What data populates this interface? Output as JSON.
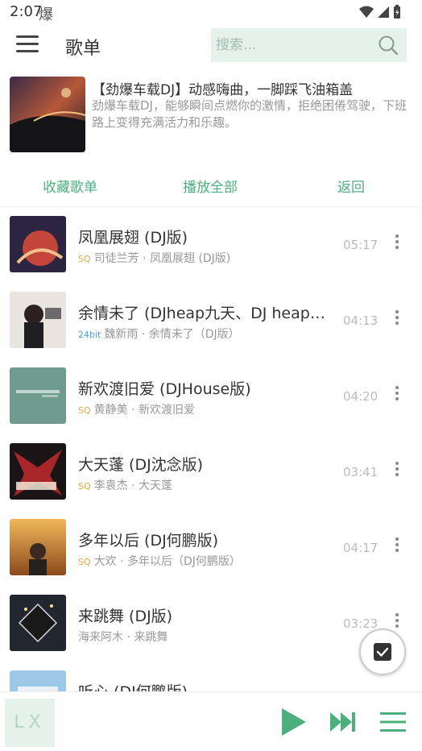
{
  "status": {
    "time": "2:07",
    "notification_glyph": "爆"
  },
  "header": {
    "title": "歌单"
  },
  "search": {
    "placeholder": "搜索..."
  },
  "playlist": {
    "name": "【劲爆车载DJ】动感嗨曲，一脚踩飞油箱盖",
    "description": "劲爆车载DJ，能够瞬间点燃你的激情，拒绝困倦驾驶，下班路上变得充满活力和乐趣。"
  },
  "actions": {
    "collect": "收藏歌单",
    "play_all": "播放全部",
    "back": "返回"
  },
  "songs": [
    {
      "title": "凤凰展翅 (DJ版)",
      "badge": "SQ",
      "meta": "司徒兰芳 · 凤凰展翅 (DJ版)",
      "duration": "05:17"
    },
    {
      "title": "余情未了 (DJheap九天、DJ heap九天)",
      "badge": "24bit",
      "meta": "魏新雨 · 余情未了（DJ版）",
      "duration": "04:13"
    },
    {
      "title": "新欢渡旧爱 (DJHouse版)",
      "badge": "SQ",
      "meta": "黄静美 · 新欢渡旧爱",
      "duration": "04:20"
    },
    {
      "title": "大天蓬 (DJ沈念版)",
      "badge": "SQ",
      "meta": "李袁杰 · 大天蓬",
      "duration": "03:41"
    },
    {
      "title": "多年以后 (DJ何鹏版)",
      "badge": "SQ",
      "meta": "大欢 · 多年以后（DJ何鹏版）",
      "duration": "04:17"
    },
    {
      "title": "来跳舞 (DJ版)",
      "badge": "",
      "meta": "海来阿木 · 来跳舞",
      "duration": "03:23"
    },
    {
      "title": "听心 (DJ何鹏版)",
      "badge": "",
      "meta": "",
      "duration": ""
    }
  ],
  "player": {
    "logo": "LX"
  },
  "colors": {
    "accent": "#4caf7e",
    "search_bg": "#e4f2eb"
  }
}
